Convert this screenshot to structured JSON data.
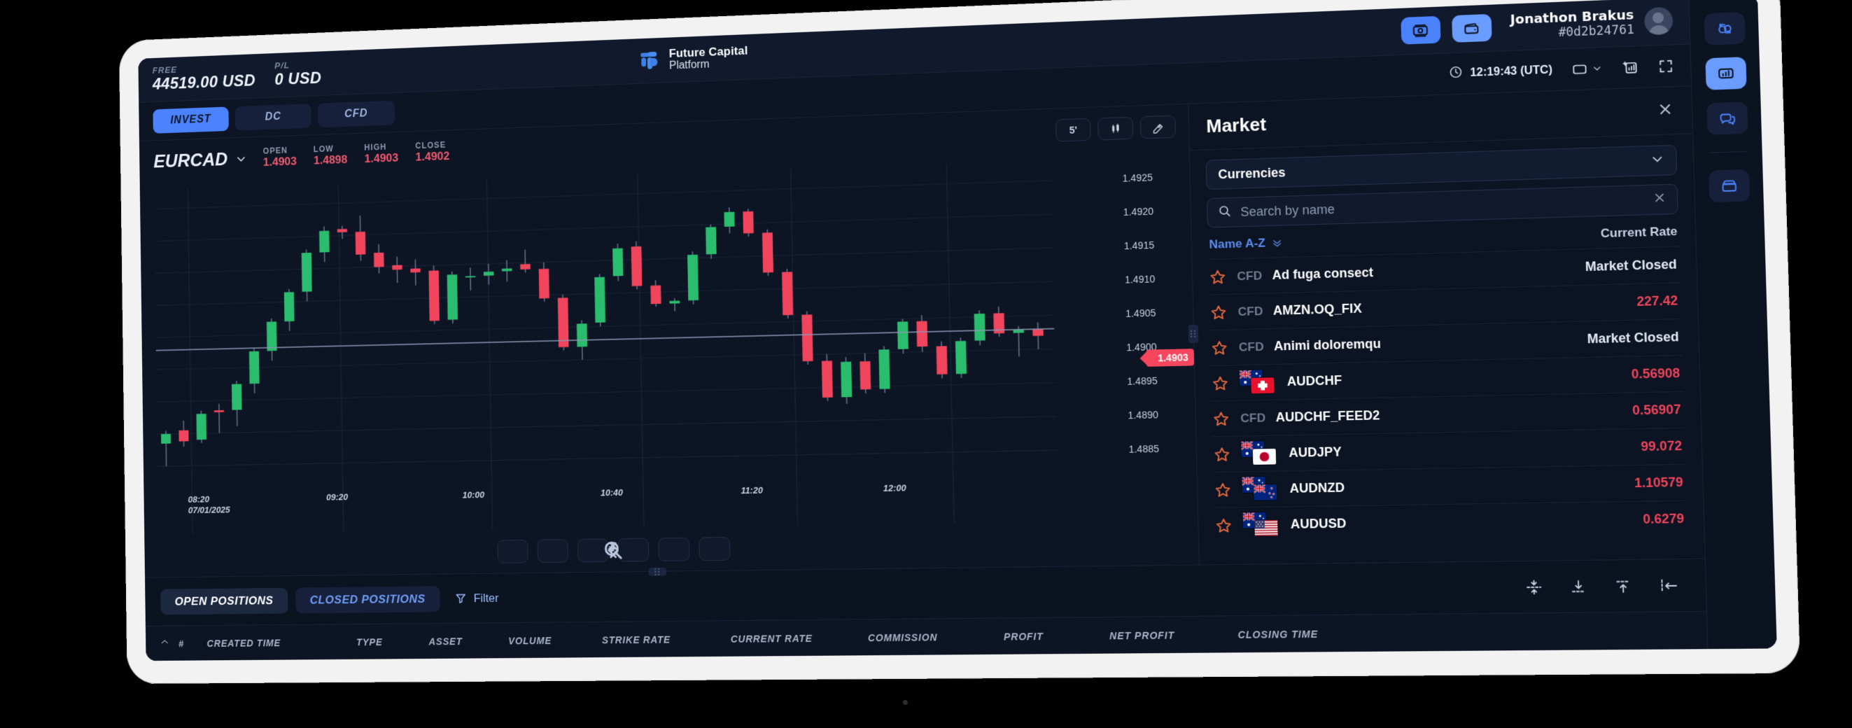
{
  "topbar": {
    "free_label": "FREE",
    "free_value": "44519.00 USD",
    "pl_label": "P/L",
    "pl_value": "0 USD",
    "brand_line1": "Future Capital",
    "brand_line2": "Platform",
    "deposit_icon": "deposit-icon",
    "wallet_icon": "wallet-icon",
    "user_name": "Jonathon Brakus",
    "user_id": "#0d2b24761",
    "avatar_icon": "avatar-icon"
  },
  "tabstrip": {
    "tabs": [
      {
        "label": "INVEST",
        "active": false
      },
      {
        "label": "DC",
        "active": true
      },
      {
        "label": "CFD",
        "active": false
      }
    ],
    "clock_icon": "clock-icon",
    "clock": "12:19:43 (UTC)",
    "layout_icon": "layout-icon",
    "layout_chevron": "chevron-down-icon",
    "add_chart_icon": "add-chart-icon",
    "fullscreen_icon": "fullscreen-icon"
  },
  "chart": {
    "symbol": "EURCAD",
    "symbol_chevron": "chevron-down-icon",
    "ohlc": [
      {
        "key": "OPEN",
        "value": "1.4903"
      },
      {
        "key": "LOW",
        "value": "1.4898"
      },
      {
        "key": "HIGH",
        "value": "1.4903"
      },
      {
        "key": "CLOSE",
        "value": "1.4902"
      }
    ],
    "tools": [
      {
        "label": "5'",
        "name": "timeframe-button"
      },
      {
        "label": "",
        "name": "candlestick-type-button",
        "icon": "candlestick-icon"
      },
      {
        "label": "",
        "name": "drawing-tools-button",
        "icon": "pen-tag-icon"
      }
    ],
    "current_price_tag": "1.4903",
    "nav_buttons": [
      {
        "name": "scroll-left-button",
        "icon": "chevron-left-icon"
      },
      {
        "name": "zoom-in-button",
        "icon": "zoom-in-icon"
      },
      {
        "name": "zoom-out-button",
        "icon": "zoom-out-icon"
      },
      {
        "name": "zoom-reset-button",
        "icon": "zoom-reset-icon"
      },
      {
        "name": "zoom-fit-button",
        "icon": "zoom-fit-icon"
      },
      {
        "name": "scroll-right-button",
        "icon": "chevron-right-icon"
      }
    ]
  },
  "chart_data": {
    "type": "candlestick",
    "title": "EURCAD",
    "xlabel": "",
    "ylabel": "",
    "ylim": [
      1.4882,
      1.4928
    ],
    "y_ticks": [
      "1.4925",
      "1.4920",
      "1.4915",
      "1.4910",
      "1.4905",
      "1.4900",
      "1.4895",
      "1.4890",
      "1.4885"
    ],
    "y_tick_values": [
      1.4925,
      1.492,
      1.4915,
      1.491,
      1.4905,
      1.49,
      1.4895,
      1.489,
      1.4885
    ],
    "x_ticks": [
      "08:20",
      "09:20",
      "10:00",
      "10:40",
      "11:20",
      "12:00"
    ],
    "x_start_date": "07/01/2025",
    "timeframe": "5'",
    "grid": true,
    "legend": "none",
    "current_price": 1.4903,
    "up_color": "#2bbd6e",
    "down_color": "#f0455c",
    "candles": [
      {
        "t": "08:20",
        "o": 1.48885,
        "h": 1.48905,
        "l": 1.4885,
        "c": 1.489,
        "dir": "up"
      },
      {
        "t": "08:25",
        "o": 1.48905,
        "h": 1.4892,
        "l": 1.4888,
        "c": 1.48888,
        "dir": "down"
      },
      {
        "t": "08:30",
        "o": 1.4889,
        "h": 1.48935,
        "l": 1.48885,
        "c": 1.4893,
        "dir": "up"
      },
      {
        "t": "08:35",
        "o": 1.48935,
        "h": 1.48945,
        "l": 1.489,
        "c": 1.48932,
        "dir": "down"
      },
      {
        "t": "08:40",
        "o": 1.48935,
        "h": 1.4898,
        "l": 1.4891,
        "c": 1.48975,
        "dir": "up"
      },
      {
        "t": "08:45",
        "o": 1.48975,
        "h": 1.4903,
        "l": 1.4896,
        "c": 1.49025,
        "dir": "up"
      },
      {
        "t": "08:50",
        "o": 1.49025,
        "h": 1.49075,
        "l": 1.4901,
        "c": 1.4907,
        "dir": "up"
      },
      {
        "t": "08:55",
        "o": 1.4907,
        "h": 1.4912,
        "l": 1.49055,
        "c": 1.49115,
        "dir": "up"
      },
      {
        "t": "09:00",
        "o": 1.49115,
        "h": 1.4918,
        "l": 1.491,
        "c": 1.49175,
        "dir": "up"
      },
      {
        "t": "09:05",
        "o": 1.49175,
        "h": 1.49215,
        "l": 1.4916,
        "c": 1.49208,
        "dir": "up"
      },
      {
        "t": "09:10",
        "o": 1.4921,
        "h": 1.49215,
        "l": 1.49195,
        "c": 1.49205,
        "dir": "down"
      },
      {
        "t": "09:15",
        "o": 1.49205,
        "h": 1.4923,
        "l": 1.4916,
        "c": 1.4917,
        "dir": "down"
      },
      {
        "t": "09:20",
        "o": 1.49172,
        "h": 1.49185,
        "l": 1.4914,
        "c": 1.4915,
        "dir": "down"
      },
      {
        "t": "09:25",
        "o": 1.49152,
        "h": 1.49165,
        "l": 1.49125,
        "c": 1.49145,
        "dir": "down"
      },
      {
        "t": "09:30",
        "o": 1.49146,
        "h": 1.4916,
        "l": 1.4912,
        "c": 1.4914,
        "dir": "down"
      },
      {
        "t": "09:35",
        "o": 1.49142,
        "h": 1.4915,
        "l": 1.4906,
        "c": 1.49065,
        "dir": "down"
      },
      {
        "t": "09:40",
        "o": 1.49066,
        "h": 1.4914,
        "l": 1.4906,
        "c": 1.49135,
        "dir": "up"
      },
      {
        "t": "09:45",
        "o": 1.4913,
        "h": 1.49145,
        "l": 1.4911,
        "c": 1.49132,
        "dir": "up"
      },
      {
        "t": "09:50",
        "o": 1.49132,
        "h": 1.4915,
        "l": 1.49118,
        "c": 1.49138,
        "dir": "up"
      },
      {
        "t": "09:55",
        "o": 1.49138,
        "h": 1.49155,
        "l": 1.49122,
        "c": 1.49142,
        "dir": "up"
      },
      {
        "t": "10:00",
        "o": 1.49148,
        "h": 1.4917,
        "l": 1.49135,
        "c": 1.4914,
        "dir": "down"
      },
      {
        "t": "10:05",
        "o": 1.4914,
        "h": 1.4915,
        "l": 1.4909,
        "c": 1.49095,
        "dir": "down"
      },
      {
        "t": "10:10",
        "o": 1.49095,
        "h": 1.491,
        "l": 1.49015,
        "c": 1.4902,
        "dir": "down"
      },
      {
        "t": "10:15",
        "o": 1.4902,
        "h": 1.4906,
        "l": 1.49,
        "c": 1.49055,
        "dir": "up"
      },
      {
        "t": "10:20",
        "o": 1.49056,
        "h": 1.4913,
        "l": 1.4905,
        "c": 1.49125,
        "dir": "up"
      },
      {
        "t": "10:25",
        "o": 1.49126,
        "h": 1.49175,
        "l": 1.49118,
        "c": 1.49168,
        "dir": "up"
      },
      {
        "t": "10:30",
        "o": 1.4917,
        "h": 1.49178,
        "l": 1.49105,
        "c": 1.4911,
        "dir": "down"
      },
      {
        "t": "10:35",
        "o": 1.4911,
        "h": 1.49118,
        "l": 1.49078,
        "c": 1.49082,
        "dir": "down"
      },
      {
        "t": "10:40",
        "o": 1.49082,
        "h": 1.4909,
        "l": 1.4907,
        "c": 1.49086,
        "dir": "up"
      },
      {
        "t": "10:45",
        "o": 1.49086,
        "h": 1.4916,
        "l": 1.4908,
        "c": 1.49155,
        "dir": "up"
      },
      {
        "t": "10:50",
        "o": 1.49155,
        "h": 1.492,
        "l": 1.49148,
        "c": 1.49196,
        "dir": "up"
      },
      {
        "t": "10:55",
        "o": 1.49196,
        "h": 1.49225,
        "l": 1.49186,
        "c": 1.49218,
        "dir": "up"
      },
      {
        "t": "11:00",
        "o": 1.49218,
        "h": 1.49222,
        "l": 1.4918,
        "c": 1.49185,
        "dir": "down"
      },
      {
        "t": "11:05",
        "o": 1.49185,
        "h": 1.4919,
        "l": 1.4912,
        "c": 1.49125,
        "dir": "down"
      },
      {
        "t": "11:10",
        "o": 1.49125,
        "h": 1.4913,
        "l": 1.49055,
        "c": 1.4906,
        "dir": "down"
      },
      {
        "t": "11:15",
        "o": 1.4906,
        "h": 1.49065,
        "l": 1.48985,
        "c": 1.4899,
        "dir": "down"
      },
      {
        "t": "11:20",
        "o": 1.4899,
        "h": 1.49,
        "l": 1.4893,
        "c": 1.48935,
        "dir": "down"
      },
      {
        "t": "11:25",
        "o": 1.48935,
        "h": 1.48995,
        "l": 1.48925,
        "c": 1.48988,
        "dir": "up"
      },
      {
        "t": "11:30",
        "o": 1.48988,
        "h": 1.49,
        "l": 1.4894,
        "c": 1.48946,
        "dir": "down"
      },
      {
        "t": "11:35",
        "o": 1.48946,
        "h": 1.4901,
        "l": 1.4894,
        "c": 1.49005,
        "dir": "up"
      },
      {
        "t": "11:40",
        "o": 1.49005,
        "h": 1.4905,
        "l": 1.48998,
        "c": 1.49046,
        "dir": "up"
      },
      {
        "t": "11:45",
        "o": 1.49046,
        "h": 1.49055,
        "l": 1.49,
        "c": 1.49008,
        "dir": "down"
      },
      {
        "t": "11:50",
        "o": 1.49008,
        "h": 1.49015,
        "l": 1.4896,
        "c": 1.48966,
        "dir": "down"
      },
      {
        "t": "11:55",
        "o": 1.48966,
        "h": 1.4902,
        "l": 1.4896,
        "c": 1.49015,
        "dir": "up"
      },
      {
        "t": "12:00",
        "o": 1.49015,
        "h": 1.4906,
        "l": 1.49008,
        "c": 1.49055,
        "dir": "up"
      },
      {
        "t": "12:05",
        "o": 1.49055,
        "h": 1.49065,
        "l": 1.4902,
        "c": 1.49025,
        "dir": "down"
      },
      {
        "t": "12:10",
        "o": 1.49025,
        "h": 1.49035,
        "l": 1.4899,
        "c": 1.4903,
        "dir": "up"
      },
      {
        "t": "12:15",
        "o": 1.4903,
        "h": 1.4904,
        "l": 1.49,
        "c": 1.4902,
        "dir": "down"
      }
    ]
  },
  "market": {
    "title": "Market",
    "close_icon": "close-icon",
    "category": "Currencies",
    "category_chevron": "chevron-down-icon",
    "search_placeholder": "Search by name",
    "search_value": "",
    "search_icon": "search-icon",
    "search_clear_icon": "clear-icon",
    "sort_label": "Name A-Z",
    "sort_icon": "chevron-double-down-icon",
    "rate_column": "Current Rate",
    "rows": [
      {
        "star": "star-icon",
        "badge": "CFD",
        "flags": null,
        "name": "Ad fuga consect",
        "rate": "Market Closed",
        "rate_type": "closed"
      },
      {
        "star": "star-icon",
        "badge": "CFD",
        "flags": null,
        "name": "AMZN.OQ_FIX",
        "rate": "227.42",
        "rate_type": "num"
      },
      {
        "star": "star-icon",
        "badge": "CFD",
        "flags": null,
        "name": "Animi doloremqu",
        "rate": "Market Closed",
        "rate_type": "closed"
      },
      {
        "star": "star-icon",
        "badge": null,
        "flags": [
          "AU",
          "CH"
        ],
        "name": "AUDCHF",
        "rate": "0.56908",
        "rate_type": "num"
      },
      {
        "star": "star-icon",
        "badge": "CFD",
        "flags": null,
        "name": "AUDCHF_FEED2",
        "rate": "0.56907",
        "rate_type": "num"
      },
      {
        "star": "star-icon",
        "badge": null,
        "flags": [
          "AU",
          "JP"
        ],
        "name": "AUDJPY",
        "rate": "99.072",
        "rate_type": "num"
      },
      {
        "star": "star-icon",
        "badge": null,
        "flags": [
          "AU",
          "NZ"
        ],
        "name": "AUDNZD",
        "rate": "1.10579",
        "rate_type": "num"
      },
      {
        "star": "star-icon",
        "badge": null,
        "flags": [
          "AU",
          "US"
        ],
        "name": "AUDUSD",
        "rate": "0.6279",
        "rate_type": "num"
      }
    ]
  },
  "dock": {
    "tabs": [
      {
        "label": "OPEN POSITIONS",
        "active": true
      },
      {
        "label": "CLOSED POSITIONS",
        "active": false
      }
    ],
    "filter_label": "Filter",
    "filter_icon": "filter-icon",
    "actions": [
      {
        "name": "collapse-both-button",
        "icon": "collapse-both-icon"
      },
      {
        "name": "collapse-down-button",
        "icon": "collapse-down-icon"
      },
      {
        "name": "collapse-up-button",
        "icon": "collapse-up-icon"
      },
      {
        "name": "collapse-left-button",
        "icon": "collapse-left-icon"
      }
    ],
    "sort_icon": "chevron-double-up-icon",
    "columns": [
      "#",
      "CREATED TIME",
      "TYPE",
      "ASSET",
      "VOLUME",
      "STRIKE RATE",
      "CURRENT RATE",
      "COMMISSION",
      "PROFIT",
      "NET PROFIT",
      "CLOSING TIME"
    ]
  },
  "rail": {
    "buttons": [
      {
        "name": "rail-exchange-button",
        "icon": "exchange-icon",
        "active": false
      },
      {
        "name": "rail-market-button",
        "icon": "bar-chart-icon",
        "active": true
      },
      {
        "name": "rail-chat-button",
        "icon": "chat-icon",
        "active": false
      },
      {
        "name": "rail-folder-button",
        "icon": "folder-icon",
        "active": false
      }
    ]
  },
  "colors": {
    "accent": "#4b83ff",
    "accent_light": "#6a9bff",
    "up": "#2bbd6e",
    "down": "#f0455c",
    "price_tag": "#f6465d",
    "bg": "#0d1424",
    "panel": "#0c1322"
  }
}
